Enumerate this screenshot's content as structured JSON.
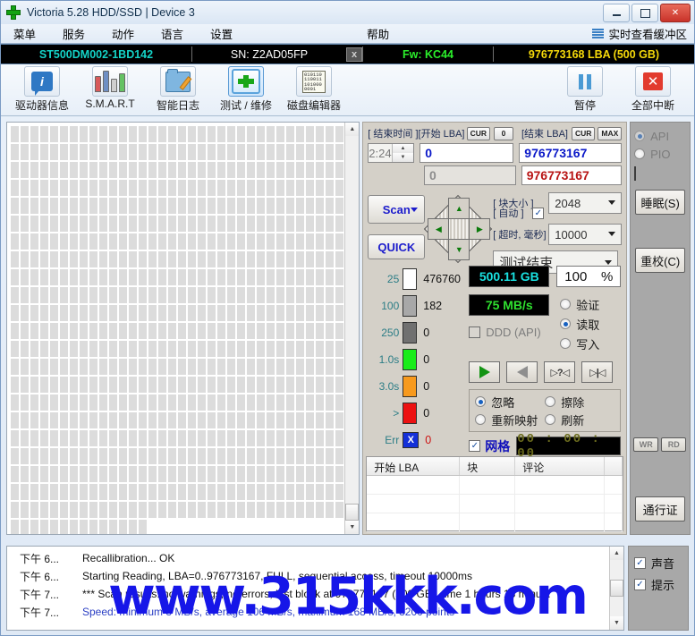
{
  "window": {
    "title": "Victoria 5.28 HDD/SSD | Device 3",
    "logo_icon": "green-cross-icon",
    "minimize_label": "",
    "maximize_label": "",
    "close_label": "✕"
  },
  "menu": {
    "items": [
      {
        "label": "菜单",
        "name": "menu-main"
      },
      {
        "label": "服务",
        "name": "menu-service"
      },
      {
        "label": "动作",
        "name": "menu-actions"
      },
      {
        "label": "语言",
        "name": "menu-language"
      },
      {
        "label": "设置",
        "name": "menu-settings"
      },
      {
        "label": "帮助",
        "name": "menu-help"
      }
    ],
    "realtime_buffer": "实时查看缓冲区"
  },
  "drive_bar": {
    "model": "ST500DM002-1BD142",
    "serial": "SN: Z2AD05FP",
    "close_btn": "x",
    "firmware": "Fw: KC44",
    "capacity": "976773168 LBA (500 GB)"
  },
  "toolbar": {
    "buttons": [
      {
        "label": "驱动器信息",
        "icon": "info-icon",
        "active": false
      },
      {
        "label": "S.M.A.R.T",
        "icon": "smart-chart-icon",
        "active": false
      },
      {
        "label": "智能日志",
        "icon": "folder-edit-icon",
        "active": false
      },
      {
        "label": "测试 / 维修",
        "icon": "medkit-icon",
        "active": true
      },
      {
        "label": "磁盘编辑器",
        "icon": "hex-editor-icon",
        "active": false
      }
    ],
    "hex_sample": "010110\n110011\n101000\n0001",
    "pause": {
      "label": "暂停",
      "icon": "pause-icon"
    },
    "stop_all": {
      "label": "全部中断",
      "icon": "stop-x-icon"
    }
  },
  "scan_panel": {
    "end_time_label": "[ 结束时间 ]",
    "end_time_value": "2:24",
    "start_lba_label": "[开始 LBA]",
    "start_lba_cur": "CUR",
    "start_lba_zero": "0",
    "end_lba_label": "[结束 LBA]",
    "end_lba_cur": "CUR",
    "end_lba_max": "MAX",
    "start_lba_value": "0",
    "end_lba_value": "976773167",
    "start_lba_second": "0",
    "end_lba_second": "976773167",
    "scan_button": "Scan",
    "quick_button": "QUICK",
    "block_size_label": "[ 块大小 ]",
    "auto_label": "[ 自动 ]",
    "auto_checked": true,
    "block_size_value": "2048",
    "timeout_label": "[ 超时, 毫秒]",
    "timeout_value": "10000",
    "end_action_value": "测试结束"
  },
  "legend": {
    "rows": [
      {
        "threshold": "25",
        "color": "#ffffff",
        "count": "476760"
      },
      {
        "threshold": "100",
        "color": "#a8a8a8",
        "count": "182"
      },
      {
        "threshold": "250",
        "color": "#707070",
        "count": "0"
      },
      {
        "threshold": "1.0s",
        "color": "#1aec1a",
        "count": "0"
      },
      {
        "threshold": "3.0s",
        "color": "#f79a1e",
        "count": "0"
      },
      {
        "threshold": ">",
        "color": "#ec1111",
        "count": "0"
      },
      {
        "threshold": "Err",
        "color": "#1430d8",
        "count": "0"
      }
    ]
  },
  "status": {
    "capacity_done": "500.11 GB",
    "percent_value": "100",
    "percent_sign": "%",
    "speed": "75 MB/s",
    "ddd_label": "DDD (API)",
    "ddd_checked": false,
    "modes": [
      {
        "label": "验证",
        "selected": false
      },
      {
        "label": "读取",
        "selected": true
      },
      {
        "label": "写入",
        "selected": false
      }
    ],
    "transport": [
      {
        "name": "play-forward-icon",
        "glyph": ""
      },
      {
        "name": "play-backward-icon",
        "glyph": ""
      },
      {
        "name": "step-query-icon",
        "glyph": "▷?◁"
      },
      {
        "name": "skip-end-icon",
        "glyph": "▷|◁"
      }
    ],
    "actions": [
      {
        "label": "忽略",
        "selected": true
      },
      {
        "label": "擦除",
        "selected": false
      },
      {
        "label": "重新映射",
        "selected": false
      },
      {
        "label": "刷新",
        "selected": false
      }
    ],
    "grid_label": "网格",
    "grid_checked": true,
    "clock": "00 : 00 : 00"
  },
  "defect_table": {
    "columns": [
      "开始 LBA",
      "块",
      "评论",
      ""
    ],
    "rows": []
  },
  "sidebar": {
    "api_label": "API",
    "api_selected": true,
    "pio_label": "PIO",
    "pio_selected": false,
    "sleep_button": "睡眠(S)",
    "recal_button": "重校(C)",
    "wr_button": "WR",
    "rd_button": "RD",
    "passport_button": "通行证"
  },
  "log": {
    "entries": [
      {
        "time": "下午 6...",
        "message": "Recallibration... OK",
        "link": false
      },
      {
        "time": "下午 6...",
        "message": "Starting Reading, LBA=0..976773167, FULL, sequential access, timeout 10000ms",
        "link": false
      },
      {
        "time": "下午 7...",
        "message": "*** Scan results: no warnings, no errors, last block at 976773167 (500 GB), time 1 hours 15 minu...",
        "link": false
      },
      {
        "time": "下午 7...",
        "message": "Speed: minimum 3 MB/s, average 106 MB/s, maximum 168 MB/s, 3200 points",
        "link": true
      }
    ],
    "sound_label": "声音",
    "sound_checked": true,
    "hint_label": "提示",
    "hint_checked": true
  },
  "watermark": "www.315kkk.com"
}
